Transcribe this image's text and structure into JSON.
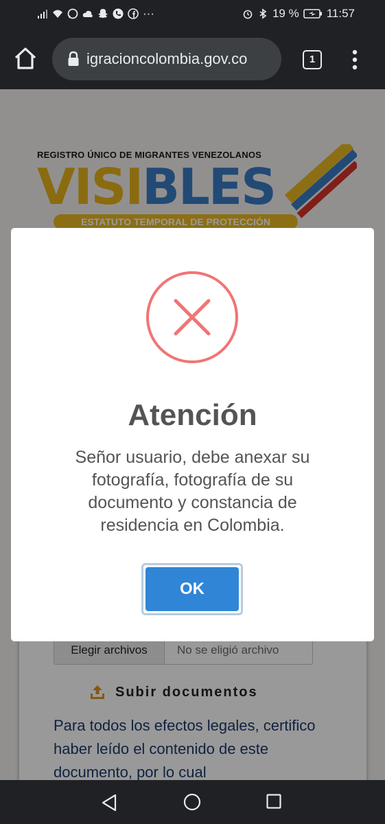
{
  "status_bar": {
    "battery_percent": "19 %",
    "time": "11:57",
    "notification_icons": [
      "signal-icon",
      "wifi-icon",
      "whatsapp-icon",
      "cloud-icon",
      "snapchat-icon",
      "phone-icon",
      "facebook-icon",
      "more-dots"
    ],
    "system_icons": [
      "alarm-icon",
      "bluetooth-icon",
      "battery-icon"
    ],
    "more_dots": "···"
  },
  "browser": {
    "url": "igracioncolombia.gov.co",
    "tab_count": "1"
  },
  "page": {
    "banner": {
      "tagline": "REGISTRO ÚNICO DE MIGRANTES VENEZOLANOS",
      "logo_part1": "VIS",
      "logo_part2": "I",
      "logo_part3": "BLES",
      "subtitle": "ESTATUTO TEMPORAL DE PROTECCIÓN"
    },
    "file_input": {
      "button_label": "Elegir archivos",
      "status": "No se eligió archivo"
    },
    "upload_label": "Subir documentos",
    "legal_text": "Para todos los efectos legales, certifico haber leído el contenido de este documento, por lo cual"
  },
  "modal": {
    "icon": "error-x-icon",
    "title": "Atención",
    "message": "Señor usuario, debe anexar su fotografía, fotografía de su documento y constancia de residencia en Colombia.",
    "ok_label": "OK"
  },
  "colors": {
    "accent": "#3085d6",
    "error": "#f27474",
    "chrome_bg": "#202124"
  }
}
